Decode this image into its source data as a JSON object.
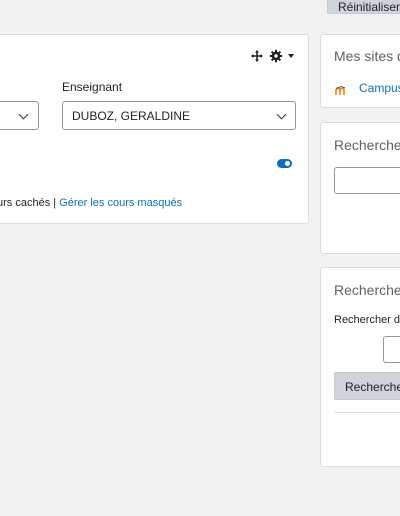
{
  "top": {
    "reset_label": "Réinitialiser"
  },
  "course_block": {
    "teacher_label": "Enseignant",
    "teacher_selected": "DUBOZ, GERALDINE",
    "hidden_courses_text": "urs cachés",
    "separator": "|",
    "manage_hidden_link": "Gérer les cours masqués",
    "toggle_on": true,
    "accent": "#0f6cbf"
  },
  "my_sites_block": {
    "title": "Mes sites d",
    "campus_link": "Campus"
  },
  "search_block": {
    "title": "Recherche"
  },
  "search_course_block": {
    "title": "Rechercher",
    "label": "Rechercher d",
    "button_label": "Rechercher"
  }
}
